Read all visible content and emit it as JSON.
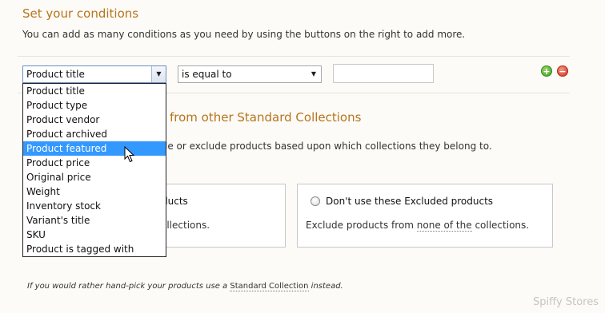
{
  "conditions": {
    "title": "Set your conditions",
    "description": "You can add as many conditions as you need by using the buttons on the right to add more."
  },
  "condition_row": {
    "field_value": "Product title",
    "operator_value": "is equal to",
    "value_input": "",
    "add_icon": "plus-circle-icon",
    "remove_icon": "minus-circle-icon"
  },
  "dropdown": {
    "items": [
      "Product title",
      "Product type",
      "Product vendor",
      "Product archived",
      "Product featured",
      "Product price",
      "Original price",
      "Weight",
      "Inventory stock",
      "Variant's title",
      "SKU",
      "Product is tagged with"
    ],
    "highlighted_index": 4
  },
  "collections": {
    "title_tail": "from other Standard Collections",
    "description_tail": "le or exclude products based upon which collections they belong to.",
    "left_panel": {
      "heading_tail": "ducts",
      "text_tail": "ollections."
    },
    "right_panel": {
      "heading": "Don't use these Excluded products",
      "text_prefix": "Exclude products from ",
      "text_link": "none of the",
      "text_suffix": " collections."
    }
  },
  "footer": {
    "note_prefix": "If you would rather hand-pick your products use a ",
    "note_link": "Standard Collection",
    "note_suffix": " instead."
  },
  "watermark": "Spiffy Stores",
  "colors": {
    "accent": "#b7741c",
    "selection": "#3399ff",
    "add": "#3e9a1e",
    "remove": "#d22e1a"
  }
}
